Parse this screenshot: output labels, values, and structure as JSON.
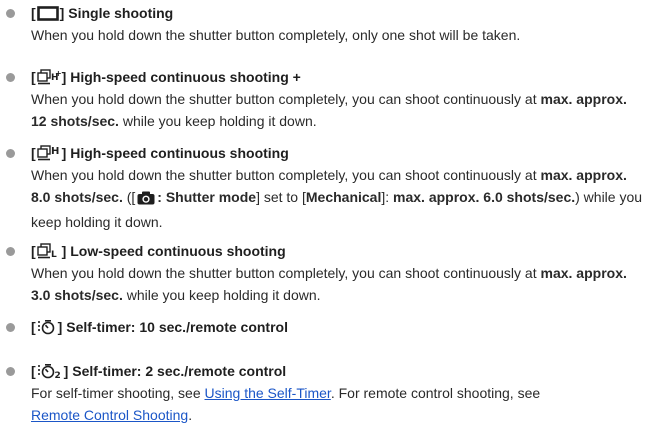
{
  "items": [
    {
      "mode_icon": "single-frame-icon",
      "title": "Single shooting",
      "desc": "When you hold down the shutter button completely, only one shot will be taken."
    },
    {
      "mode_icon": "high-speed-plus-icon",
      "title": "High-speed continuous shooting +",
      "desc_1": "When you hold down the shutter button completely, you can shoot continuously at ",
      "desc_bold": "max. approx. 12 shots/sec.",
      "desc_2": " while you keep holding it down."
    },
    {
      "mode_icon": "high-speed-icon",
      "title": "High-speed continuous shooting",
      "desc_1": "When you hold down the shutter button completely, you can shoot continuously at ",
      "desc_bold_1": "max. approx. 8.0 shots/sec.",
      "desc_2": " ([",
      "camera_icon": "camera-icon",
      "desc_bold_2": ": Shutter mode",
      "desc_3": "] set to [",
      "desc_bold_3": "Mechanical",
      "desc_4": "]: ",
      "desc_bold_4": "max. approx. 6.0 shots/sec.",
      "desc_5": ") while you keep holding it down."
    },
    {
      "mode_icon": "low-speed-icon",
      "title": "Low-speed continuous shooting",
      "desc_1": "When you hold down the shutter button completely, you can shoot continuously at ",
      "desc_bold": "max. approx. 3.0 shots/sec.",
      "desc_2": " while you keep holding it down."
    },
    {
      "mode_icon": "self-timer-10-icon",
      "title": "Self-timer: 10 sec./remote control"
    },
    {
      "mode_icon": "self-timer-2-icon",
      "title": "Self-timer: 2 sec./remote control",
      "desc_1": "For self-timer shooting, see ",
      "link_1": "Using the Self-Timer",
      "desc_2": ". For remote control shooting, see ",
      "link_2": "Remote Control Shooting",
      "desc_3": "."
    }
  ],
  "colors": {
    "link": "#1b56c7",
    "bullet": "#9a9a9a",
    "text": "#222222"
  }
}
